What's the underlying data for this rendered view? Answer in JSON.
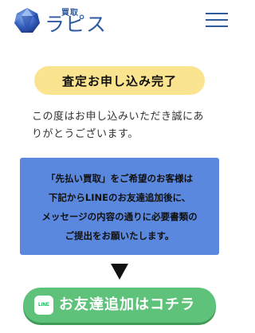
{
  "header": {
    "logo_small": "買取",
    "logo_main": "ラピス",
    "logo_icon": "gem-icon",
    "menu_icon": "hamburger-menu-icon"
  },
  "status": {
    "title": "査定お申し込み完了"
  },
  "thanks": {
    "text": "この度はお申し込みいただき誠にありがとうございます。"
  },
  "notice": {
    "lines": [
      "「先払い買取」をご希望のお客様は",
      "下記からLINEのお友達追加後に、",
      "メッセージの内容の通りに必要書類の",
      "ご提出をお願いたします。"
    ]
  },
  "cta": {
    "icon_text": "LINE",
    "label": "お友達追加はコチラ"
  },
  "colors": {
    "brand_blue": "#2d5aa0",
    "pill_yellow": "#fbe48f",
    "notice_blue": "#5a88de",
    "line_green": "#5ec27a"
  }
}
